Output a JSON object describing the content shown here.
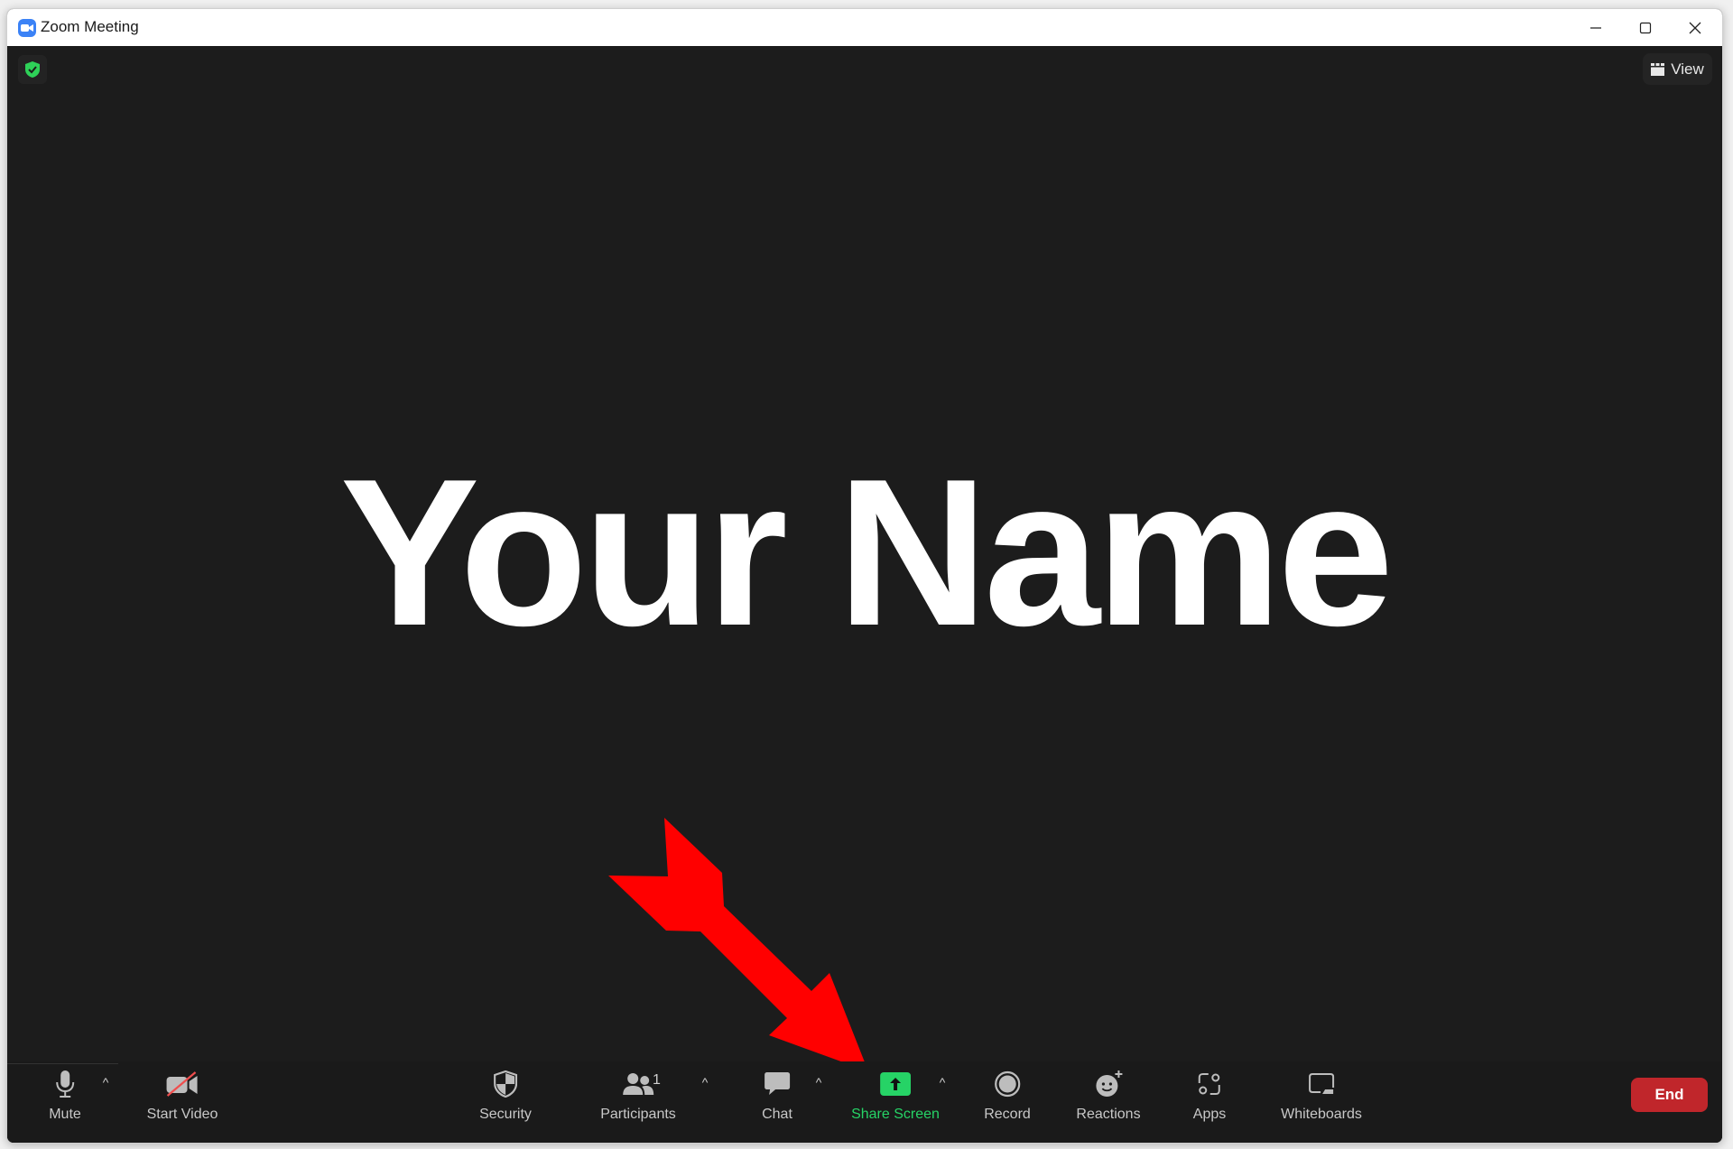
{
  "window": {
    "title": "Zoom Meeting",
    "controls": {
      "minimize": "minimize",
      "maximize": "maximize",
      "close": "close"
    }
  },
  "stage": {
    "security_badge": "shield-check-icon",
    "view_label": "View",
    "participant_name": "Your Name"
  },
  "annotation": {
    "type": "arrow",
    "color": "#ff0000",
    "points_to": "Share Screen"
  },
  "toolbar": {
    "mute": {
      "label": "Mute",
      "icon": "microphone-icon"
    },
    "start_video": {
      "label": "Start Video",
      "icon": "video-off-icon"
    },
    "security": {
      "label": "Security",
      "icon": "shield-icon"
    },
    "participants": {
      "label": "Participants",
      "icon": "participants-icon",
      "count": "1"
    },
    "chat": {
      "label": "Chat",
      "icon": "chat-icon"
    },
    "share_screen": {
      "label": "Share Screen",
      "icon": "share-screen-icon",
      "color": "#26d366"
    },
    "record": {
      "label": "Record",
      "icon": "record-icon"
    },
    "reactions": {
      "label": "Reactions",
      "icon": "reactions-icon"
    },
    "apps": {
      "label": "Apps",
      "icon": "apps-icon"
    },
    "whiteboards": {
      "label": "Whiteboards",
      "icon": "whiteboard-icon"
    },
    "end": {
      "label": "End",
      "color": "#c0262b"
    },
    "caret": "^"
  }
}
